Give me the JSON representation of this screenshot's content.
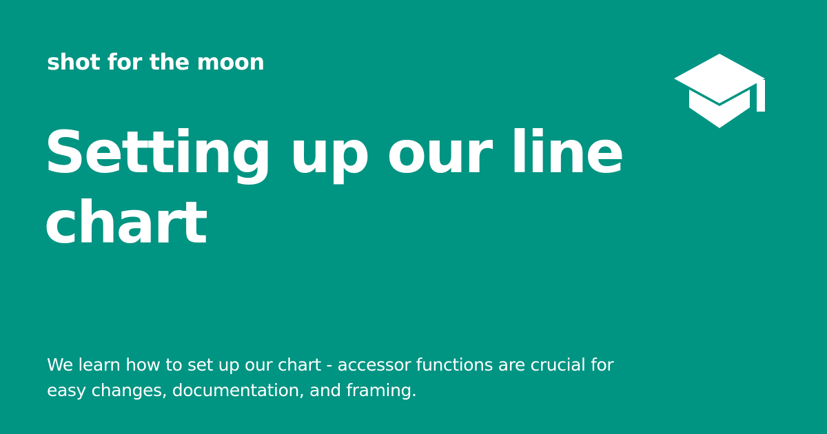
{
  "site": {
    "name": "shot for the moon",
    "logo_icon": "graduation-cap-icon"
  },
  "article": {
    "title": "Setting up our line chart",
    "description": "We learn how to set up our chart - accessor functions are crucial for easy changes, documentation, and framing."
  },
  "colors": {
    "background": "#009482",
    "foreground": "#ffffff"
  }
}
